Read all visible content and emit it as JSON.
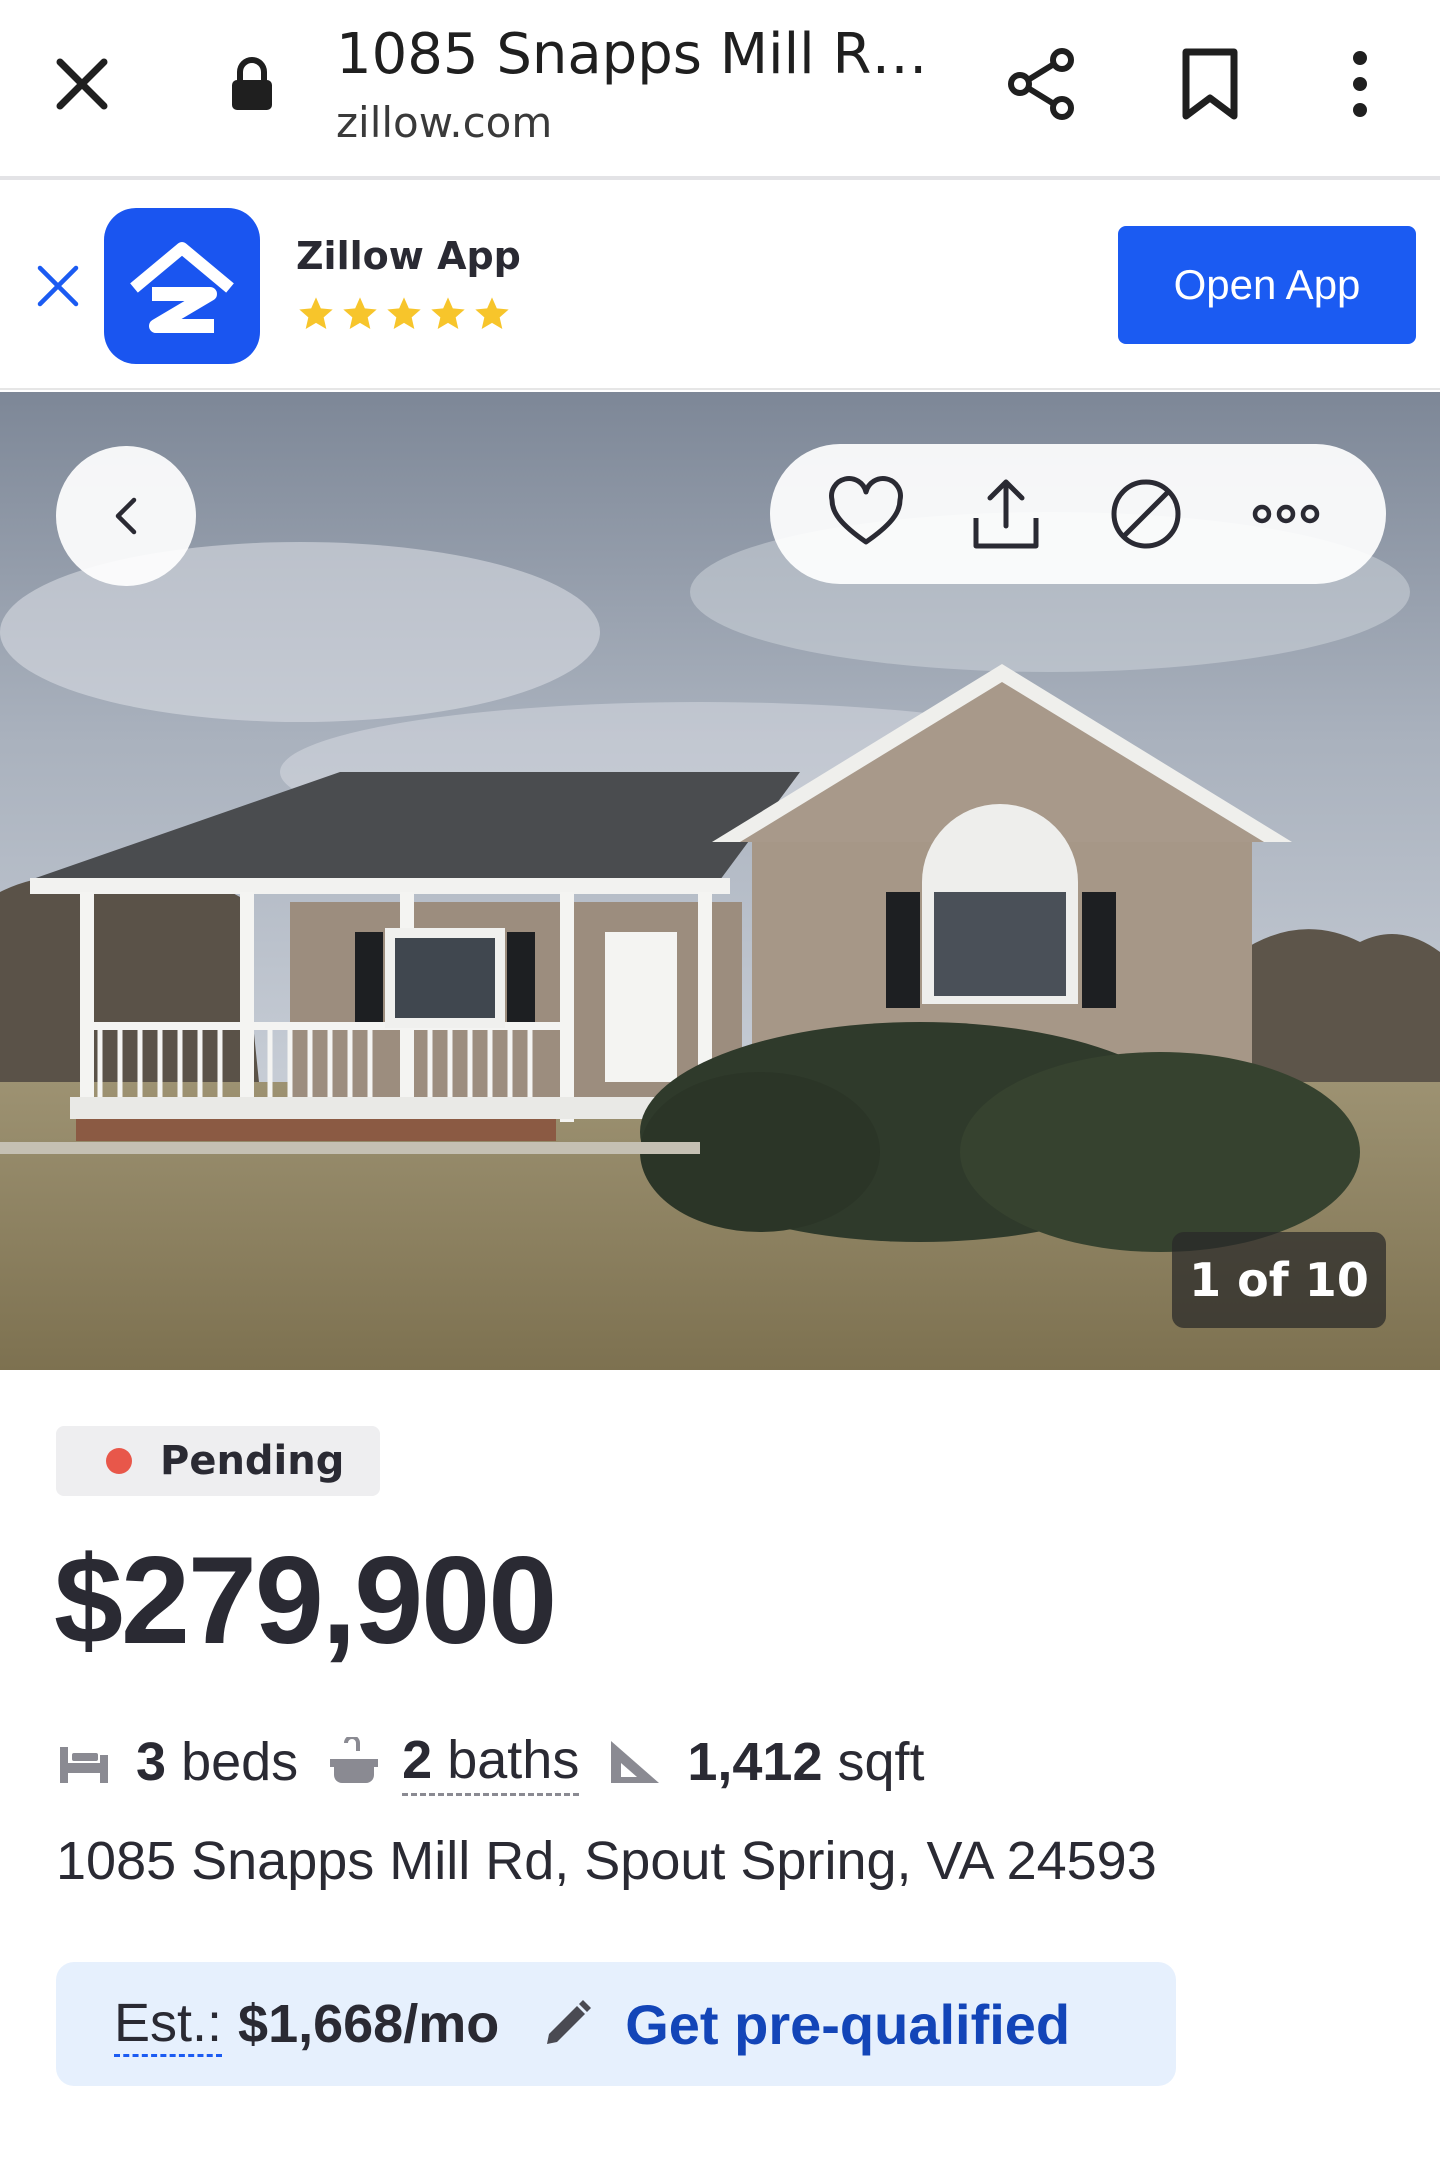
{
  "browser": {
    "page_title": "1085 Snapps Mill Rd...",
    "domain": "zillow.com",
    "icons": [
      "close-icon",
      "lock-icon",
      "share-icon",
      "bookmark-icon",
      "more-vert-icon"
    ]
  },
  "app_banner": {
    "app_name": "Zillow App",
    "rating_stars": 5,
    "open_label": "Open App",
    "accent": "#1b5bf2",
    "star_color": "#f7c52b"
  },
  "photo": {
    "counter": "1 of 10",
    "actions": [
      "heart-icon",
      "share-upload-icon",
      "hide-icon",
      "more-horiz-icon"
    ]
  },
  "listing": {
    "status": "Pending",
    "status_color": "#e8574a",
    "price": "$279,900",
    "beds_value": "3",
    "beds_unit": "beds",
    "baths_value": "2",
    "baths_unit": "baths",
    "sqft_value": "1,412",
    "sqft_unit": "sqft",
    "address": "1085 Snapps Mill Rd, Spout Spring, VA 24593"
  },
  "estimate": {
    "label": "Est.:",
    "value": "$1,668/mo",
    "cta": "Get pre-qualified"
  }
}
